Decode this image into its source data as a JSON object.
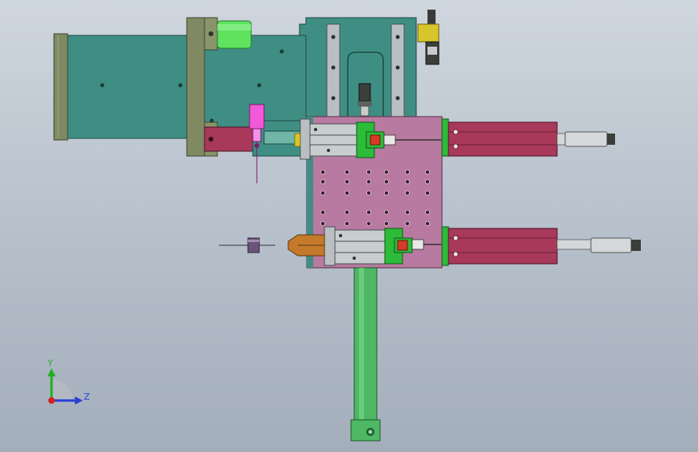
{
  "viewport": {
    "name": "cad-model-viewport",
    "background": "#b7c1cc"
  },
  "triad": {
    "y_label": "Y",
    "z_label": "Z",
    "y_color": "#1fb01f",
    "z_color": "#2a3fd6",
    "origin_color": "#d81e1e"
  },
  "colors": {
    "frame_teal": "#3f8e84",
    "olive_plate": "#7f8a63",
    "motor_green": "#5fe35f",
    "pink_plate": "#b87aa0",
    "cylinder_red": "#a8395a",
    "rail_gray": "#b9bfc2",
    "green_block": "#2dbb3a",
    "orange_block": "#c47a2a",
    "red_part": "#d83a2a",
    "magenta_part": "#f05ad8",
    "yellow_sensor": "#d7c52c",
    "column_green": "#4eb864",
    "purple_part": "#6a557a",
    "rod_gray": "#d5d8da"
  },
  "icons": {
    "triad": "coordinate-triad-icon"
  }
}
